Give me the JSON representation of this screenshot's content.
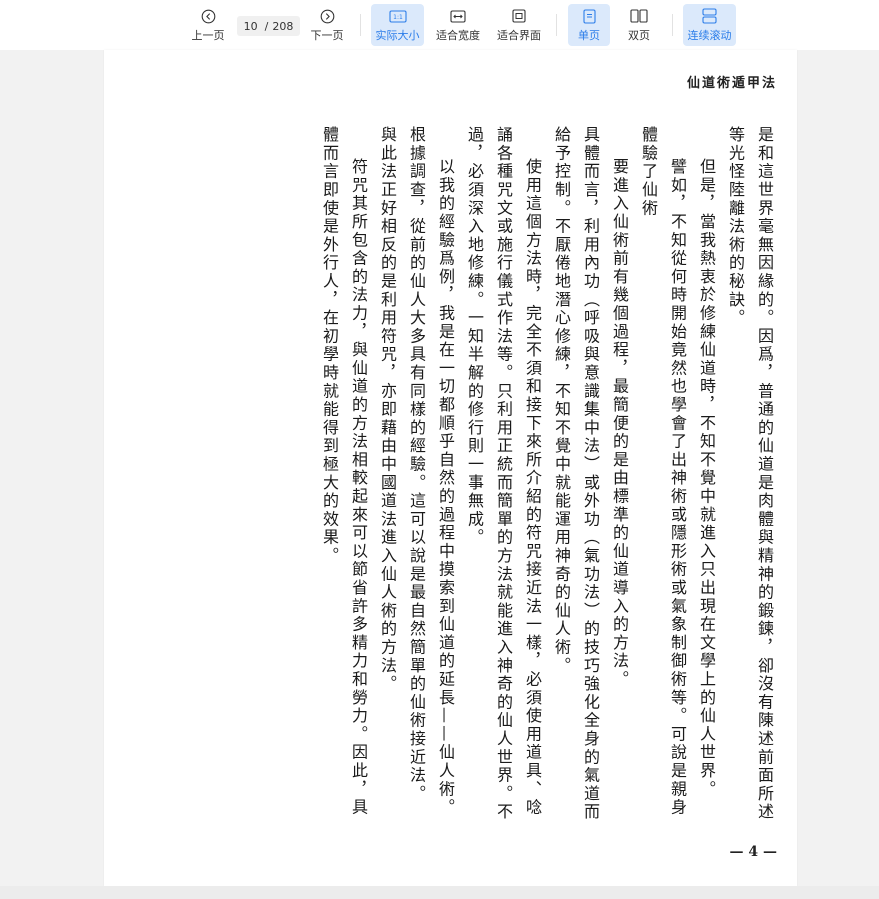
{
  "toolbar": {
    "prev_label": "上一页",
    "next_label": "下一页",
    "current_page": "10",
    "page_separator": "/",
    "total_pages": "208",
    "actual_size_icon_text": "1:1",
    "actual_size_label": "实际大小",
    "fit_width_label": "适合宽度",
    "fit_screen_label": "适合界面",
    "single_page_label": "单页",
    "double_page_label": "双页",
    "continuous_label": "连续滚动",
    "accent_color": "#2b7de9",
    "active_bg": "#dbe9fb"
  },
  "page": {
    "running_title": "仙道術遁甲法",
    "page_number": "— 4 —",
    "paragraphs": [
      {
        "text": "是和這世界毫無因緣的。因爲，普通的仙道是肉體與精神的鍛鍊，卻沒有陳述前面所述等光怪陸離法術的秘訣。",
        "indent": false
      },
      {
        "text": "但是，當我熱衷於修練仙道時，不知不覺中就進入只出現在文學上的仙人世界。",
        "indent": true
      },
      {
        "text": "譬如，不知從何時開始竟然也學會了出神術或隱形術或氣象制御術等。可說是親身體驗了仙術",
        "indent": true
      },
      {
        "text": "要進入仙術前有幾個過程，最簡便的是由標準的仙道導入的方法。",
        "indent": true
      },
      {
        "text": "具體而言，利用內功（呼吸與意識集中法）或外功（氣功法）的技巧強化全身的氣道而給予控制。不厭倦地潛心修練，不知不覺中就能運用神奇的仙人術。",
        "indent": false
      },
      {
        "text": "使用這個方法時，完全不須和接下來所介紹的符咒接近法一樣，必須使用道具、唸誦各種咒文或施行儀式作法等。只利用正統而簡單的方法就能進入神奇的仙人世界。不過，必須深入地修練。一知半解的修行則一事無成。",
        "indent": true
      },
      {
        "text": "以我的經驗爲例，我是在一切都順乎自然的過程中摸索到仙道的延長——仙人術。",
        "indent": true
      },
      {
        "text": "根據調查，從前的仙人大多具有同樣的經驗。這可以說是最自然簡單的仙術接近法。",
        "indent": false
      },
      {
        "text": "與此法正好相反的是利用符咒，亦即藉由中國道法進入仙人術的方法。",
        "indent": false
      },
      {
        "text": "符咒其所包含的法力，與仙道的方法相較起來可以節省許多精力和勞力。因此，具體而言即使是外行人，在初學時就能得到極大的效果。",
        "indent": true
      }
    ]
  }
}
